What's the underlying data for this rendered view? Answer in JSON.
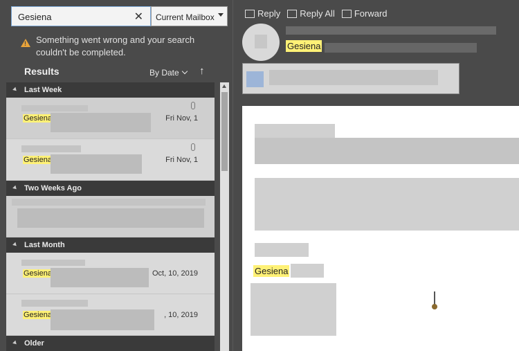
{
  "search": {
    "value": "Gesiena",
    "clear_icon": "close-icon"
  },
  "scope": {
    "label": "Current Mailbox"
  },
  "warning": {
    "icon": "warning-icon",
    "text": "Something went wrong and your search couldn't be completed."
  },
  "results": {
    "title": "Results",
    "sort_label": "By Date",
    "sort_arrow": "↑"
  },
  "groups": [
    {
      "label": "Last Week",
      "items": [
        {
          "name": "Gesiena",
          "date": "Fri Nov, 1",
          "attachment": true
        },
        {
          "name": "Gesiena",
          "date": "Fri Nov, 1",
          "attachment": true
        }
      ]
    },
    {
      "label": "Two Weeks Ago",
      "items": [
        {
          "name": "",
          "date": ""
        }
      ]
    },
    {
      "label": "Last Month",
      "items": [
        {
          "name": "Gesiena",
          "date": "Oct, 10, 2019"
        },
        {
          "name": "Gesiena",
          "date": ", 10, 2019"
        }
      ]
    },
    {
      "label": "Older",
      "items": []
    }
  ],
  "reading_pane": {
    "actions": [
      {
        "label": "Reply",
        "icon": "reply-icon"
      },
      {
        "label": "Reply All",
        "icon": "reply-all-icon"
      },
      {
        "label": "Forward",
        "icon": "forward-icon"
      }
    ],
    "sender": "Gesiena",
    "body_name": "Gesiena"
  },
  "colors": {
    "highlight": "#fff176",
    "pane_bg": "#4a4a4a",
    "accent_border": "#7aa7d6",
    "warning": "#e8a33a"
  }
}
